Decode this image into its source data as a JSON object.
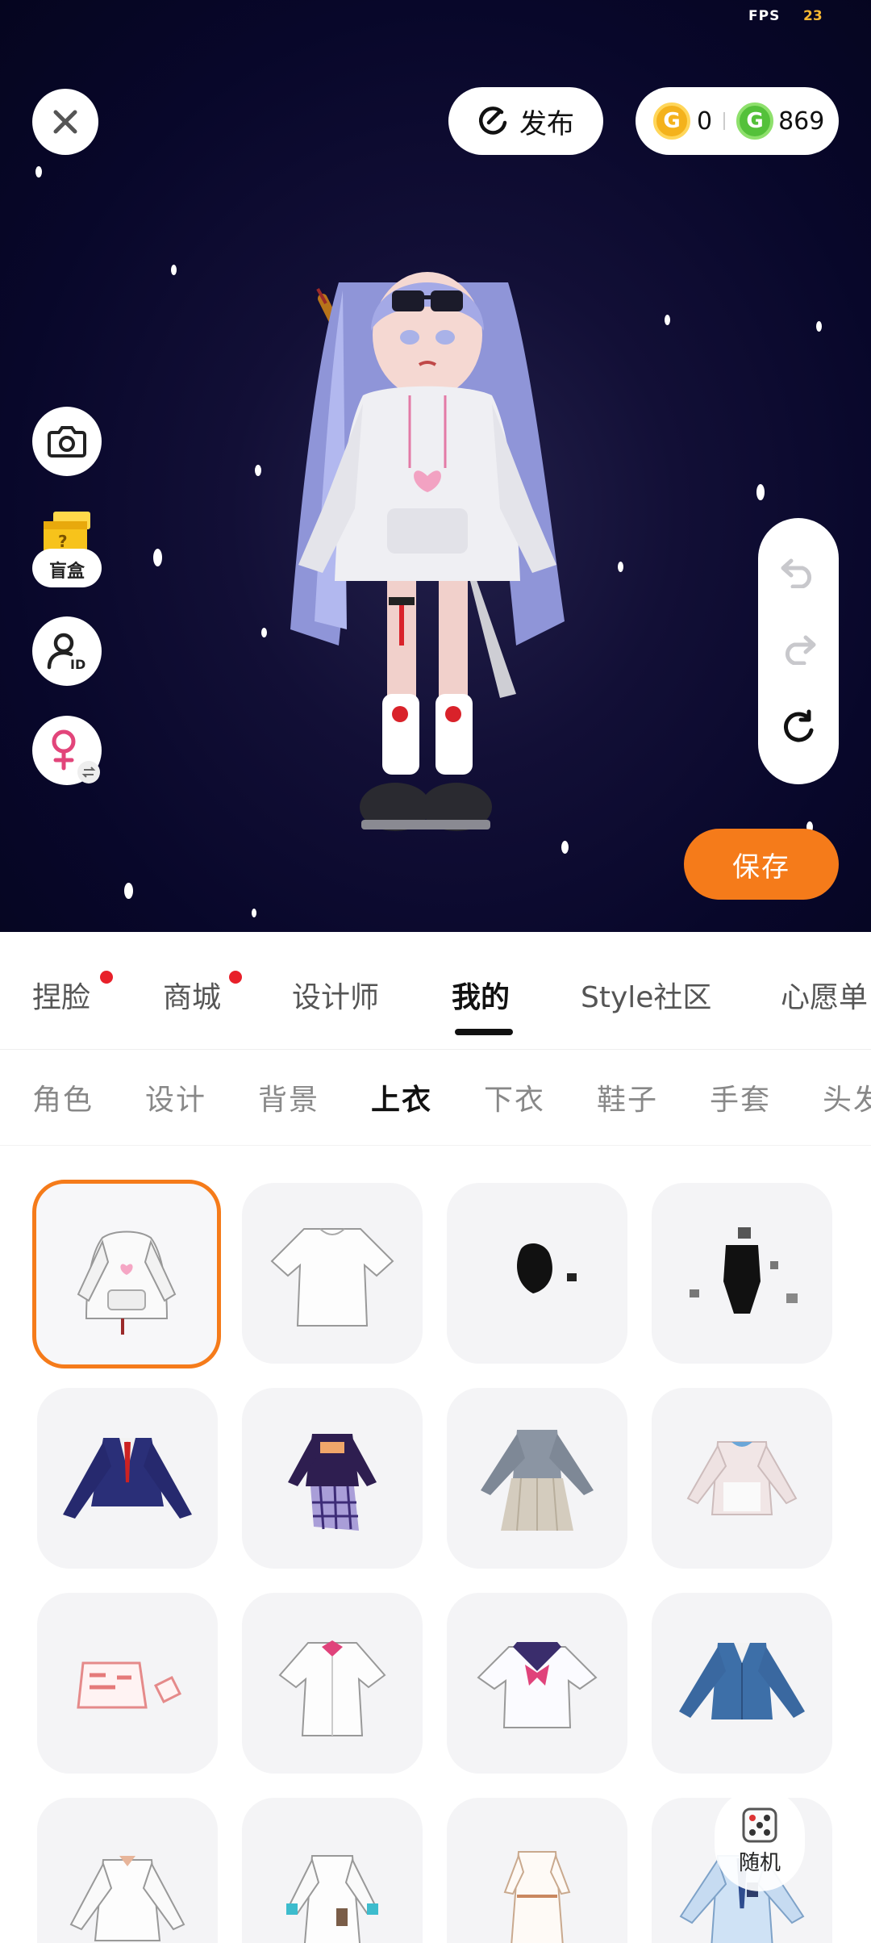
{
  "overlay": {
    "fps_label": "FPS",
    "fps_value": "23"
  },
  "toolbar": {
    "publish_label": "发布",
    "gold_coin_symbol": "G",
    "gold_amount": "0",
    "green_coin_symbol": "G",
    "green_amount": "869",
    "save_label": "保存",
    "blindbox_label": "盲盒",
    "blindbox_mark": "?",
    "id_badge": "ID"
  },
  "main_tabs": [
    {
      "label": "捏脸",
      "has_dot": true
    },
    {
      "label": "商城",
      "has_dot": true
    },
    {
      "label": "设计师",
      "has_dot": false
    },
    {
      "label": "我的",
      "active": true
    },
    {
      "label": "Style社区"
    },
    {
      "label": "心愿单"
    }
  ],
  "sub_tabs": [
    {
      "label": "角色"
    },
    {
      "label": "设计"
    },
    {
      "label": "背景"
    },
    {
      "label": "上衣",
      "active": true
    },
    {
      "label": "下衣"
    },
    {
      "label": "鞋子"
    },
    {
      "label": "手套"
    },
    {
      "label": "头发"
    }
  ],
  "items": [
    "white-hoodie",
    "white-tshirt",
    "black-accessory",
    "black-bodysuit",
    "navy-blazer",
    "purple-plaid-outfit",
    "grey-sailor-uniform",
    "pink-cardigan",
    "pink-crop-shirt",
    "white-blouse-bow",
    "sailor-top-pink-bow",
    "blue-jacket",
    "white-ruffle-blouse",
    "white-dress-belt",
    "white-long-dress",
    "light-blue-shirt"
  ],
  "random_label": "随机",
  "colors": {
    "accent": "#f57b1a",
    "notification": "#e8202a",
    "stage_bg": "#08072a"
  }
}
